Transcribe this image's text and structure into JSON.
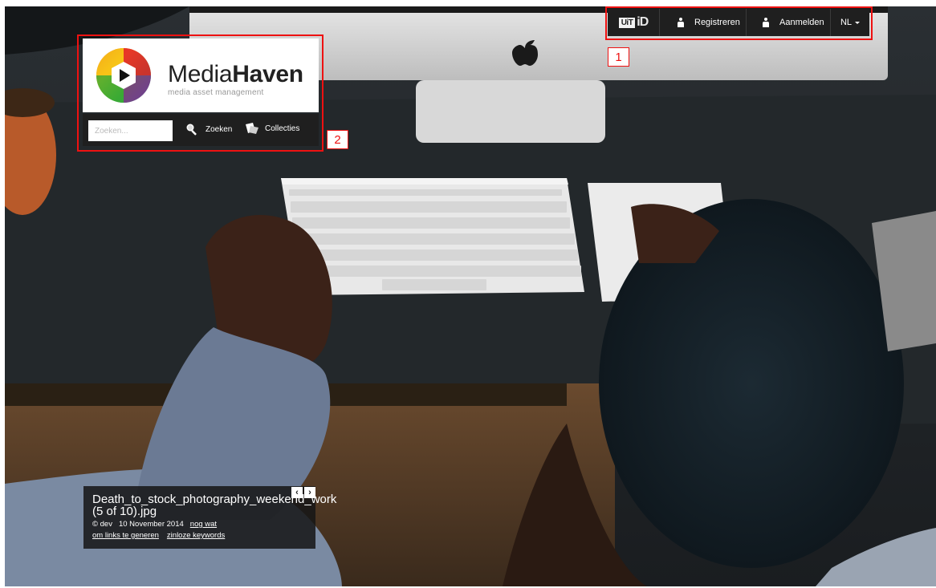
{
  "topnav": {
    "uitid_logo": {
      "box_text": "UiT",
      "suffix_text": "iD"
    },
    "register_label": "Registreren",
    "login_label": "Aanmelden",
    "language": "NL",
    "icons": {
      "register": "person-icon",
      "login": "person-icon",
      "language": "caret-down-icon"
    }
  },
  "annotations": {
    "nav_number": "1",
    "header_number": "2",
    "color": "#ee1111"
  },
  "logo": {
    "name_regular": "Media",
    "name_bold": "Haven",
    "tagline": "media asset management"
  },
  "search": {
    "placeholder": "Zoeken...",
    "value": "",
    "search_label": "Zoeken",
    "collections_label": "Collecties",
    "icons": {
      "search": "magnifier-icon",
      "collections": "folder-icon"
    }
  },
  "caption": {
    "title": "Death_to_stock_photography_weekend_work (5 of 10).jpg",
    "author": "© dev",
    "date": "10 November 2014",
    "links": [
      "nog wat",
      "om links te generen",
      "zinloze keywords"
    ],
    "prev_symbol": "‹",
    "next_symbol": "›"
  }
}
